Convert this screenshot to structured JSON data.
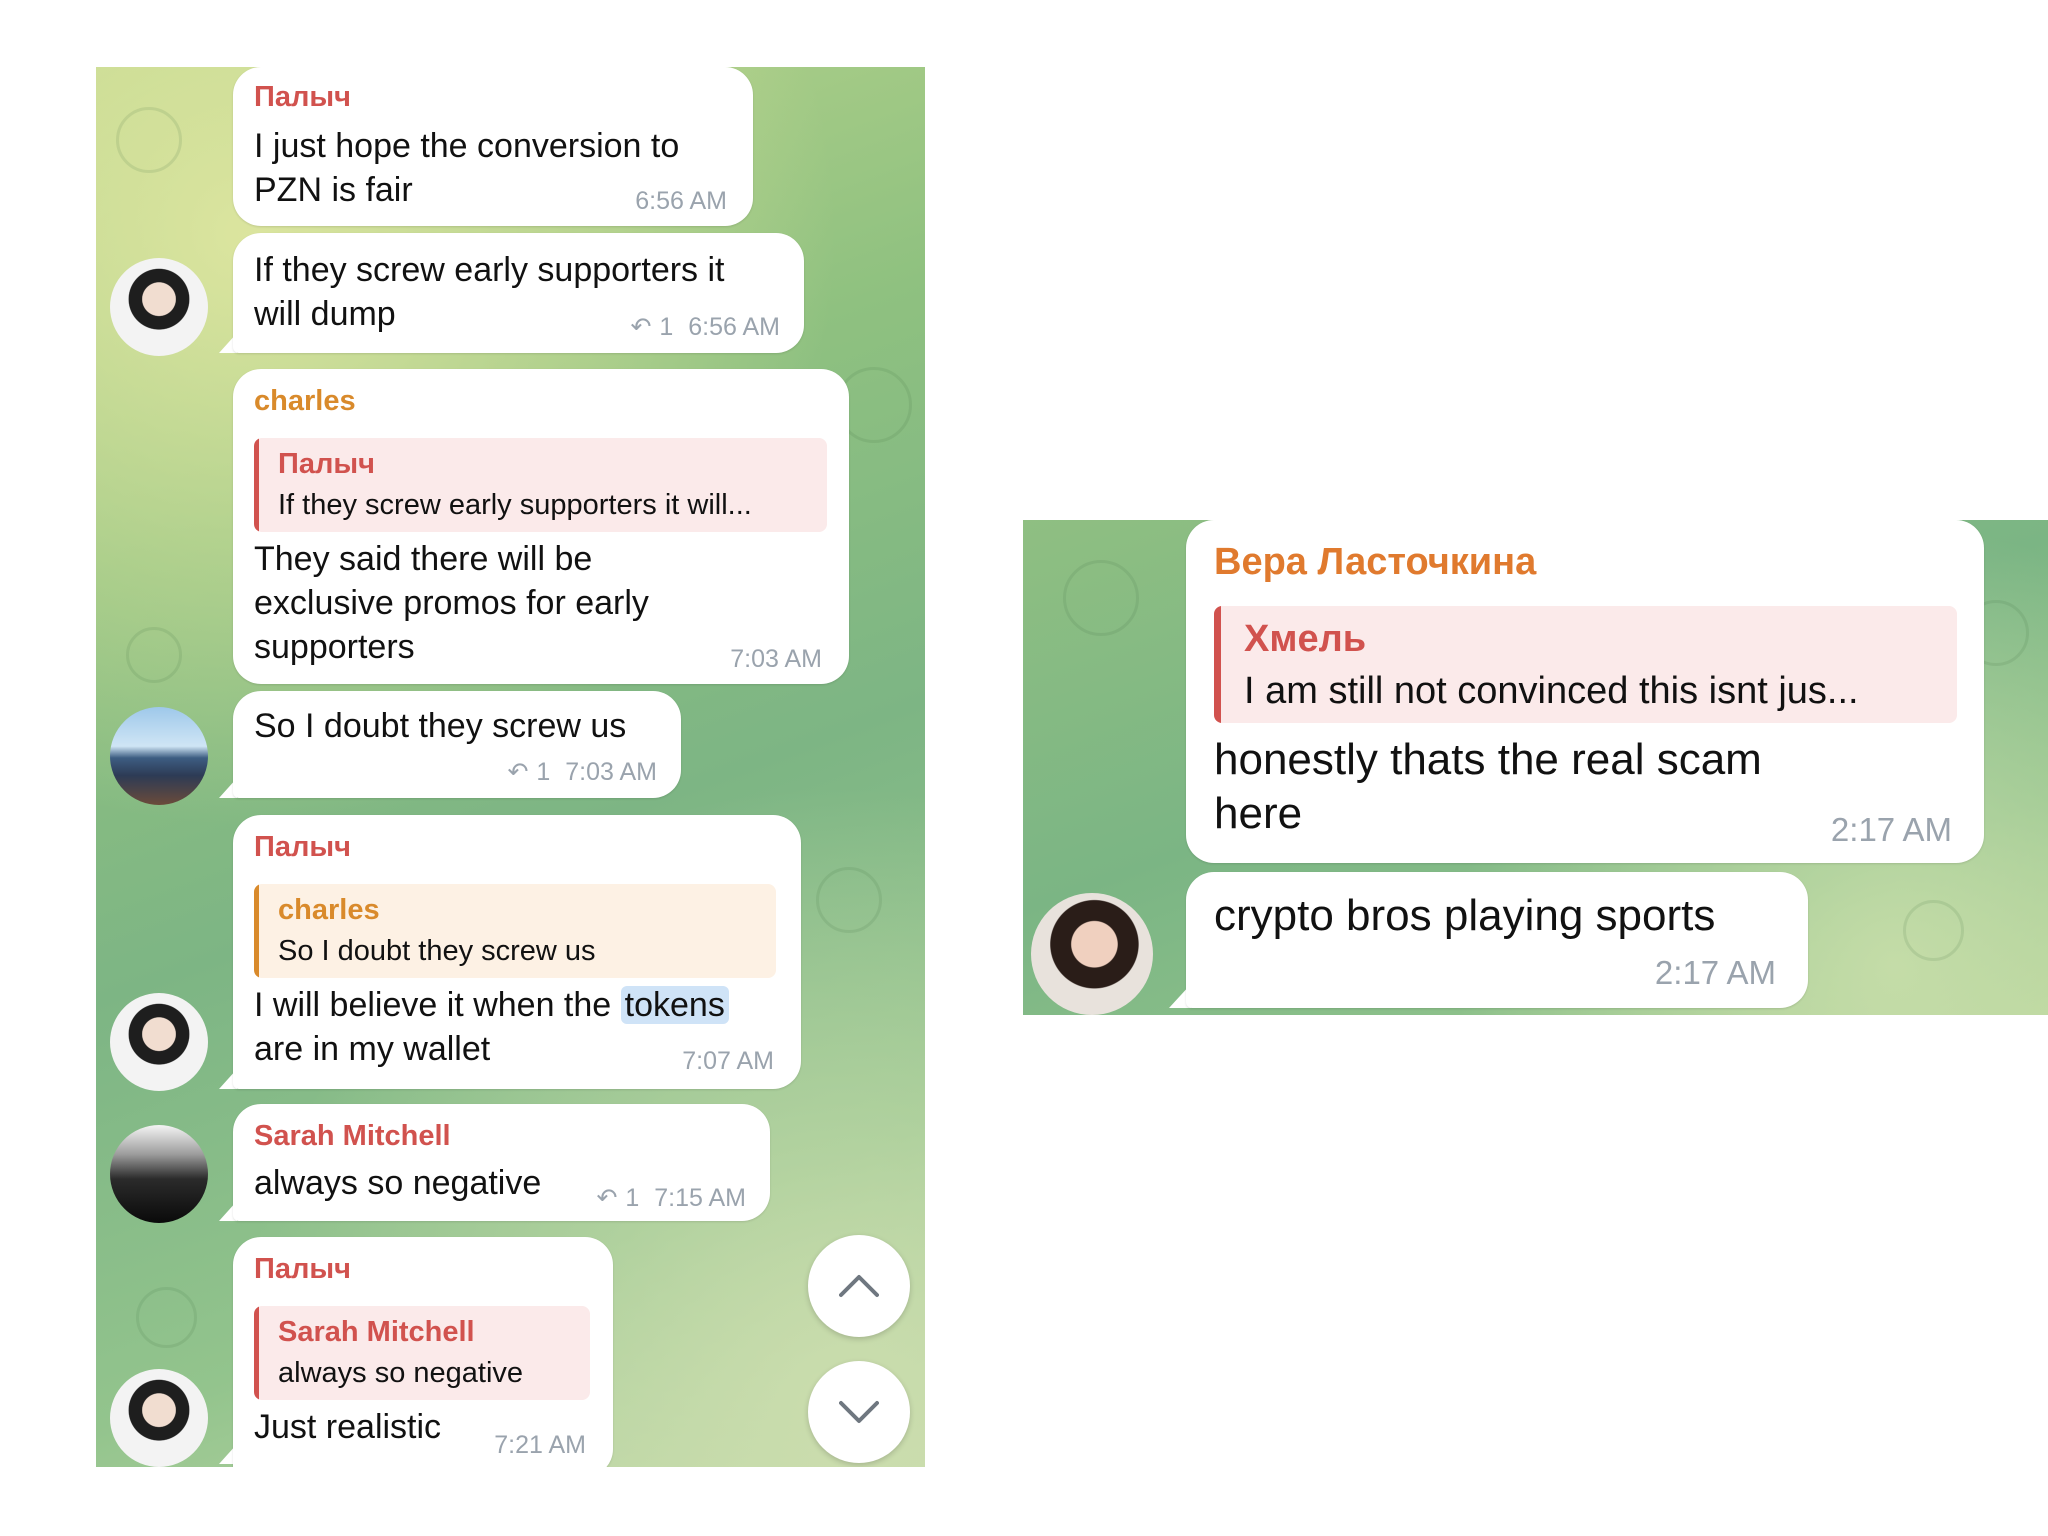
{
  "left_chat": {
    "messages": [
      {
        "sender": "Палыч",
        "sender_color": "#d1524e",
        "lines": [
          "I just hope the conversion to",
          "PZN is fair"
        ],
        "time": "6:56 AM"
      },
      {
        "lines": [
          "If they screw early supporters it",
          "will dump"
        ],
        "replies": "1",
        "time": "6:56 AM"
      },
      {
        "sender": "charles",
        "sender_color": "#d98a2b",
        "quote": {
          "name": "Палыч",
          "text": "If they screw early supporters it will..."
        },
        "lines": [
          "They said there will be",
          "exclusive promos for early",
          "supporters"
        ],
        "time": "7:03 AM"
      },
      {
        "lines": [
          "So I doubt they screw us"
        ],
        "replies": "1",
        "time": "7:03 AM"
      },
      {
        "sender": "Палыч",
        "sender_color": "#d1524e",
        "quote": {
          "name": "charles",
          "text": "So I doubt they screw us"
        },
        "line1_before": "I will believe it when the ",
        "line1_highlight": "tokens",
        "line2": "are in my wallet",
        "time": "7:07 AM"
      },
      {
        "sender": "Sarah Mitchell",
        "sender_color": "#d1524e",
        "lines": [
          "always so negative"
        ],
        "replies": "1",
        "time": "7:15 AM"
      },
      {
        "sender": "Палыч",
        "sender_color": "#d1524e",
        "quote": {
          "name": "Sarah Mitchell",
          "text": "always so negative"
        },
        "lines": [
          "Just realistic"
        ],
        "time": "7:21 AM"
      }
    ],
    "scroll_up_icon": "chevron-up-icon",
    "scroll_down_icon": "chevron-down-icon"
  },
  "right_chat": {
    "messages": [
      {
        "sender": "Вера Ласточкина",
        "sender_color": "#e07a2e",
        "quote": {
          "name": "Хмель",
          "text": "I am still not convinced this isnt jus..."
        },
        "lines": [
          "honestly thats the real scam",
          "here"
        ],
        "time": "2:17 AM"
      },
      {
        "lines": [
          "crypto bros playing sports"
        ],
        "time": "2:17 AM"
      }
    ]
  },
  "colors": {
    "quote_red_bg": "#fbeaea",
    "quote_red_bar": "#d1524e",
    "quote_orange_bg": "#fdf1e4",
    "quote_orange_bar": "#d98a2b",
    "highlight": "#cfe3f7"
  }
}
